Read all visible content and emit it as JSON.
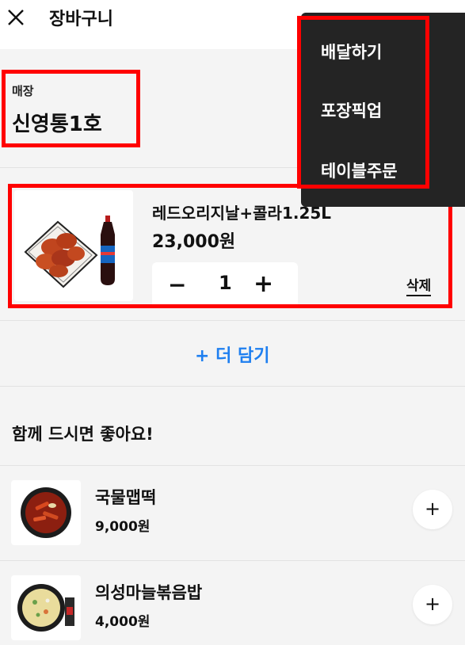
{
  "header": {
    "title": "장바구니",
    "close_icon": "close-icon"
  },
  "store": {
    "label": "매장",
    "name": "신영통1호"
  },
  "order_menu": {
    "items": [
      "배달하기",
      "포장픽업",
      "테이블주문"
    ]
  },
  "cart_item": {
    "name": "레드오리지날+콜라1.25L",
    "price": "23,000원",
    "quantity": "1",
    "minus": "−",
    "plus": "+",
    "delete_label": "삭제"
  },
  "add_more": {
    "label": "+ 더 담기"
  },
  "recommendations": {
    "title": "함께 드시면 좋아요!",
    "items": [
      {
        "name": "국물맵떡",
        "price": "9,000원",
        "add": "+"
      },
      {
        "name": "의성마늘볶음밥",
        "price": "4,000원",
        "add": "+"
      }
    ]
  },
  "colors": {
    "accent": "#1e7ff0",
    "highlight": "#ff0000",
    "menu_bg": "#242424"
  }
}
